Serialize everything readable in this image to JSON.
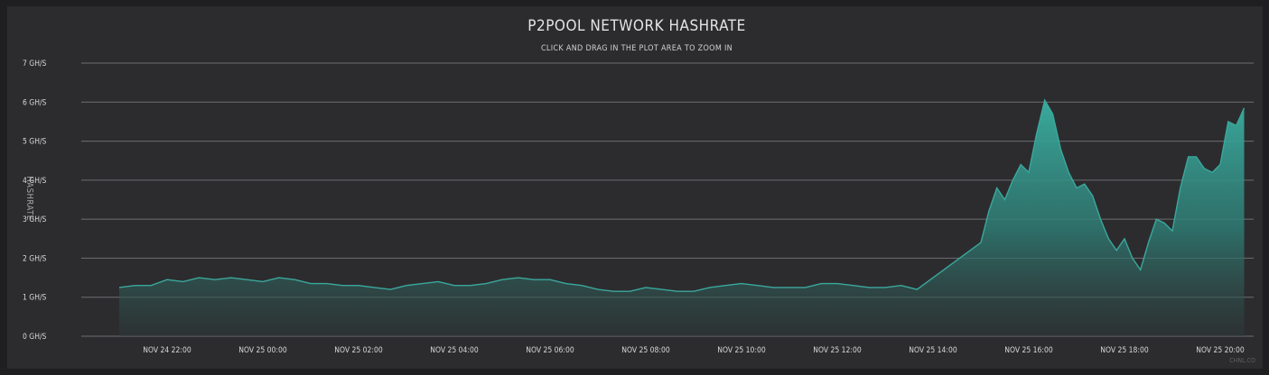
{
  "chart_data": {
    "type": "area",
    "title": "P2POOL NETWORK HASHRATE",
    "subtitle": "CLICK AND DRAG IN THE PLOT AREA TO ZOOM IN",
    "ylabel": "HASHRATE",
    "ylim": [
      0,
      7
    ],
    "yticks": [
      "0 GH/S",
      "1 GH/S",
      "2 GH/S",
      "3 GH/S",
      "4 GH/S",
      "5 GH/S",
      "6 GH/S",
      "7 GH/S"
    ],
    "xticks": [
      "NOV 24 22:00",
      "NOV 25 00:00",
      "NOV 25 02:00",
      "NOV 25 04:00",
      "NOV 25 06:00",
      "NOV 25 08:00",
      "NOV 25 10:00",
      "NOV 25 12:00",
      "NOV 25 14:00",
      "NOV 25 16:00",
      "NOV 25 18:00",
      "NOV 25 20:00"
    ],
    "series": [
      {
        "color": "#3aa89d",
        "points": [
          [
            "NOV 24 21:00",
            1.25
          ],
          [
            "NOV 24 21:20",
            1.3
          ],
          [
            "NOV 24 21:40",
            1.3
          ],
          [
            "NOV 24 22:00",
            1.45
          ],
          [
            "NOV 24 22:20",
            1.4
          ],
          [
            "NOV 24 22:40",
            1.5
          ],
          [
            "NOV 24 23:00",
            1.45
          ],
          [
            "NOV 24 23:20",
            1.5
          ],
          [
            "NOV 24 23:40",
            1.45
          ],
          [
            "NOV 25 00:00",
            1.4
          ],
          [
            "NOV 25 00:20",
            1.5
          ],
          [
            "NOV 25 00:40",
            1.45
          ],
          [
            "NOV 25 01:00",
            1.35
          ],
          [
            "NOV 25 01:20",
            1.35
          ],
          [
            "NOV 25 01:40",
            1.3
          ],
          [
            "NOV 25 02:00",
            1.3
          ],
          [
            "NOV 25 02:20",
            1.25
          ],
          [
            "NOV 25 02:40",
            1.2
          ],
          [
            "NOV 25 03:00",
            1.3
          ],
          [
            "NOV 25 03:20",
            1.35
          ],
          [
            "NOV 25 03:40",
            1.4
          ],
          [
            "NOV 25 04:00",
            1.3
          ],
          [
            "NOV 25 04:20",
            1.3
          ],
          [
            "NOV 25 04:40",
            1.35
          ],
          [
            "NOV 25 05:00",
            1.45
          ],
          [
            "NOV 25 05:20",
            1.5
          ],
          [
            "NOV 25 05:40",
            1.45
          ],
          [
            "NOV 25 06:00",
            1.45
          ],
          [
            "NOV 25 06:20",
            1.35
          ],
          [
            "NOV 25 06:40",
            1.3
          ],
          [
            "NOV 25 07:00",
            1.2
          ],
          [
            "NOV 25 07:20",
            1.15
          ],
          [
            "NOV 25 07:40",
            1.15
          ],
          [
            "NOV 25 08:00",
            1.25
          ],
          [
            "NOV 25 08:20",
            1.2
          ],
          [
            "NOV 25 08:40",
            1.15
          ],
          [
            "NOV 25 09:00",
            1.15
          ],
          [
            "NOV 25 09:20",
            1.25
          ],
          [
            "NOV 25 09:40",
            1.3
          ],
          [
            "NOV 25 10:00",
            1.35
          ],
          [
            "NOV 25 10:20",
            1.3
          ],
          [
            "NOV 25 10:40",
            1.25
          ],
          [
            "NOV 25 11:00",
            1.25
          ],
          [
            "NOV 25 11:20",
            1.25
          ],
          [
            "NOV 25 11:40",
            1.35
          ],
          [
            "NOV 25 12:00",
            1.35
          ],
          [
            "NOV 25 12:20",
            1.3
          ],
          [
            "NOV 25 12:40",
            1.25
          ],
          [
            "NOV 25 13:00",
            1.25
          ],
          [
            "NOV 25 13:20",
            1.3
          ],
          [
            "NOV 25 13:40",
            1.2
          ],
          [
            "NOV 25 14:00",
            1.5
          ],
          [
            "NOV 25 14:20",
            1.8
          ],
          [
            "NOV 25 14:40",
            2.1
          ],
          [
            "NOV 25 15:00",
            2.4
          ],
          [
            "NOV 25 15:10",
            3.2
          ],
          [
            "NOV 25 15:20",
            3.8
          ],
          [
            "NOV 25 15:30",
            3.5
          ],
          [
            "NOV 25 15:40",
            4.0
          ],
          [
            "NOV 25 15:50",
            4.4
          ],
          [
            "NOV 25 16:00",
            4.2
          ],
          [
            "NOV 25 16:10",
            5.2
          ],
          [
            "NOV 25 16:20",
            6.05
          ],
          [
            "NOV 25 16:30",
            5.7
          ],
          [
            "NOV 25 16:40",
            4.8
          ],
          [
            "NOV 25 16:50",
            4.2
          ],
          [
            "NOV 25 17:00",
            3.8
          ],
          [
            "NOV 25 17:10",
            3.9
          ],
          [
            "NOV 25 17:20",
            3.6
          ],
          [
            "NOV 25 17:30",
            3.0
          ],
          [
            "NOV 25 17:40",
            2.5
          ],
          [
            "NOV 25 17:50",
            2.2
          ],
          [
            "NOV 25 18:00",
            2.5
          ],
          [
            "NOV 25 18:10",
            2.0
          ],
          [
            "NOV 25 18:20",
            1.7
          ],
          [
            "NOV 25 18:30",
            2.4
          ],
          [
            "NOV 25 18:40",
            3.0
          ],
          [
            "NOV 25 18:50",
            2.9
          ],
          [
            "NOV 25 19:00",
            2.7
          ],
          [
            "NOV 25 19:10",
            3.8
          ],
          [
            "NOV 25 19:20",
            4.6
          ],
          [
            "NOV 25 19:30",
            4.6
          ],
          [
            "NOV 25 19:40",
            4.3
          ],
          [
            "NOV 25 19:50",
            4.2
          ],
          [
            "NOV 25 20:00",
            4.4
          ],
          [
            "NOV 25 20:10",
            5.5
          ],
          [
            "NOV 25 20:20",
            5.4
          ],
          [
            "NOV 25 20:30",
            5.85
          ]
        ]
      }
    ],
    "grid": true,
    "legend": "none"
  },
  "credit": "CHNL.CO"
}
